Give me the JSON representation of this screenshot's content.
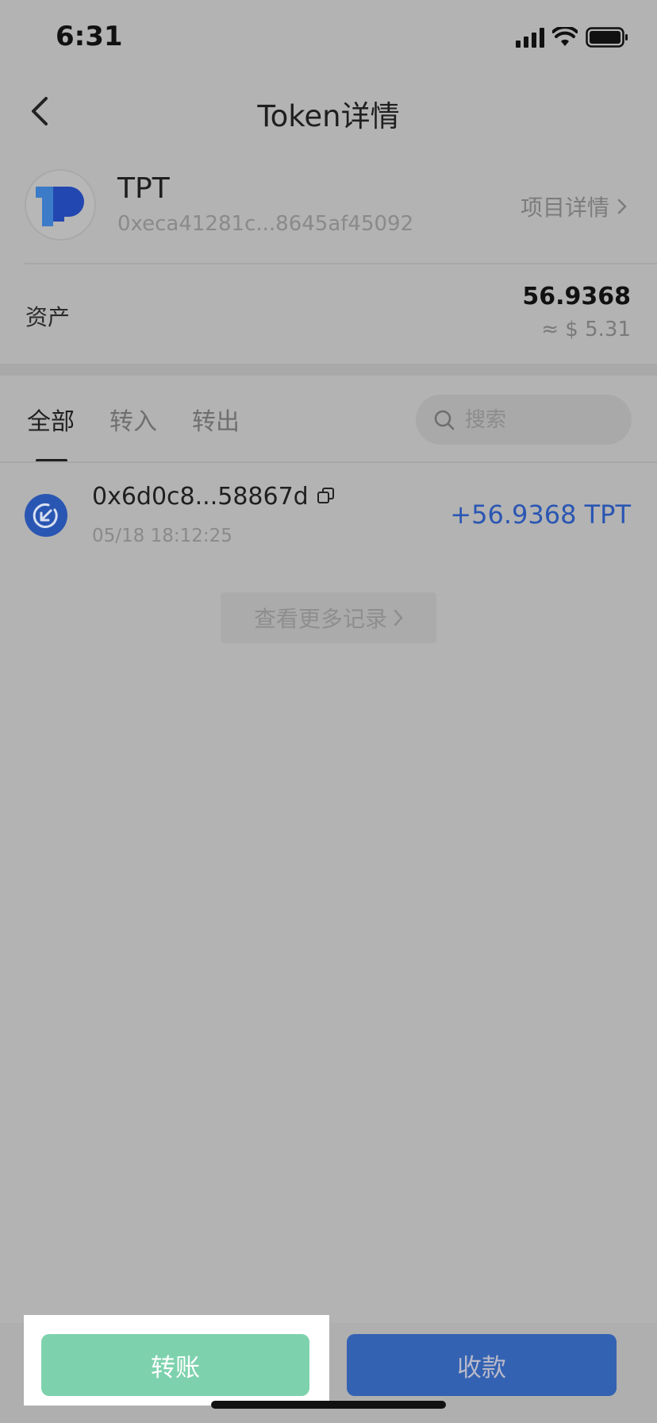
{
  "status_bar": {
    "time": "6:31",
    "icons": [
      "cellular-signal-icon",
      "wifi-icon",
      "battery-icon"
    ]
  },
  "nav": {
    "title": "Token详情",
    "back_icon": "chevron-left-icon"
  },
  "token": {
    "symbol": "TPT",
    "address": "0xeca41281c...8645af45092",
    "project_detail_label": "项目详情",
    "logo_icon": "tokenpocket-logo"
  },
  "asset": {
    "label": "资产",
    "amount": "56.9368",
    "fiat": "≈ $ 5.31"
  },
  "tabs": [
    {
      "label": "全部",
      "active": true
    },
    {
      "label": "转入",
      "active": false
    },
    {
      "label": "转出",
      "active": false
    }
  ],
  "search": {
    "placeholder": "搜索"
  },
  "transactions": [
    {
      "address": "0x6d0c8...58867d",
      "time": "05/18 18:12:25",
      "amount": "+56.9368 TPT",
      "direction_icon": "incoming-arrow-icon"
    }
  ],
  "more_records_label": "查看更多记录",
  "actions": {
    "transfer_label": "转账",
    "receive_label": "收款"
  },
  "colors": {
    "accent_blue": "#2a56b3",
    "transfer_green": "#7dd2ad",
    "receive_blue": "#3362b2"
  }
}
